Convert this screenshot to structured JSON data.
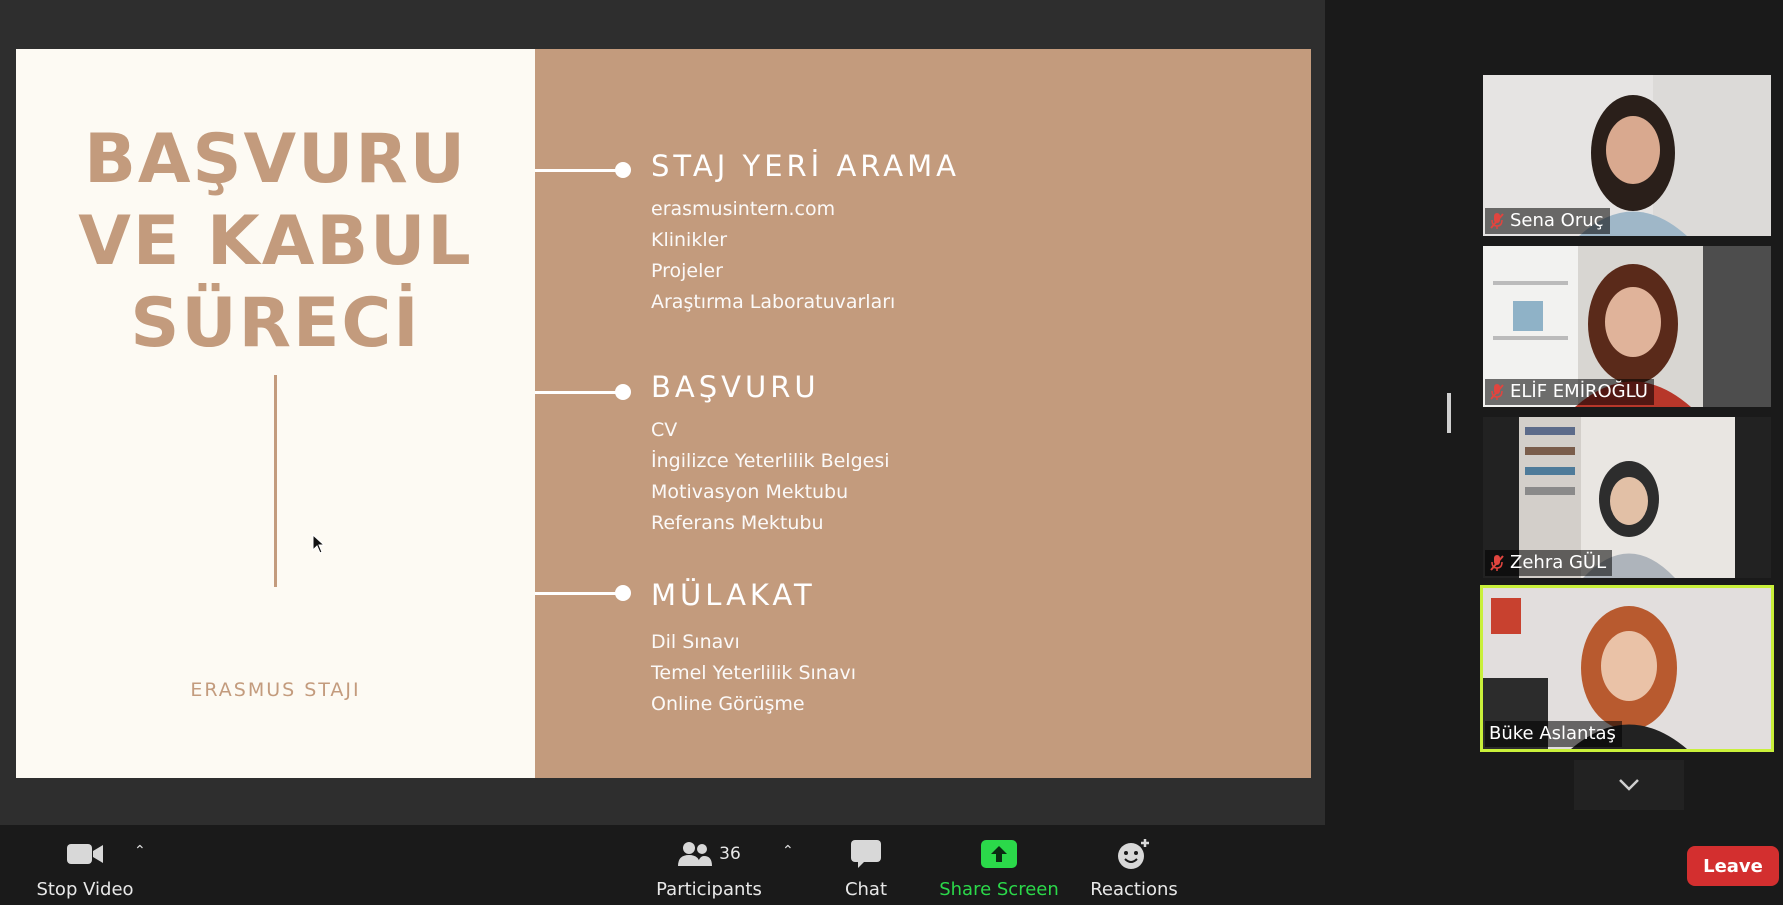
{
  "slide": {
    "title_lines": [
      "BAŞVURU",
      "VE KABUL",
      "SÜRECİ"
    ],
    "footer": "ERASMUS STAJI",
    "sections": [
      {
        "heading": "STAJ YERİ ARAMA",
        "items": [
          "erasmusintern.com",
          "Klinikler",
          "Projeler",
          "Araştırma Laboratuvarları"
        ]
      },
      {
        "heading": "BAŞVURU",
        "items": [
          "CV",
          "İngilizce Yeterlilik Belgesi",
          "Motivasyon Mektubu",
          "Referans Mektubu"
        ]
      },
      {
        "heading": "MÜLAKAT",
        "items": [
          "Dil Sınavı",
          "Temel Yeterlilik Sınavı",
          "Online Görüşme"
        ]
      }
    ]
  },
  "participants": [
    {
      "name": "Sena Oruç",
      "muted": true
    },
    {
      "name": "ELİF EMİROĞLU",
      "muted": true
    },
    {
      "name": "Zehra GÜL",
      "muted": true
    },
    {
      "name": "Büke Aslantaş",
      "muted": false,
      "speaking": true
    }
  ],
  "toolbar": {
    "stop_video": "Stop Video",
    "participants": "Participants",
    "participants_count": "36",
    "chat": "Chat",
    "share_screen": "Share Screen",
    "reactions": "Reactions",
    "leave": "Leave"
  },
  "icons": {
    "video": "video-camera-icon",
    "participants": "people-icon",
    "chat": "chat-bubble-icon",
    "share": "share-up-arrow-icon",
    "reactions": "smiley-plus-icon",
    "mic_muted": "mic-muted-icon",
    "chevron": "chevron-down-icon"
  },
  "colors": {
    "slide_accent": "#c39b7d",
    "slide_bg": "#fdfaf3",
    "share_green": "#2bd94a",
    "leave_red": "#d32f2f",
    "active_speaker": "#c9f03a",
    "muted_red": "#e0453f"
  }
}
